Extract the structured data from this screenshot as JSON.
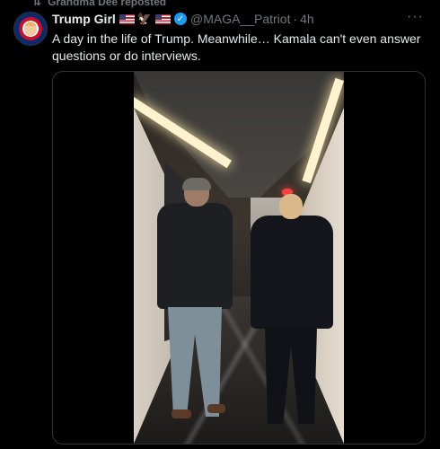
{
  "repost": {
    "icon": "repost-icon",
    "text": "Grandma Dee reposted"
  },
  "tweet": {
    "display_name": "Trump Girl",
    "badges": [
      "us-flag-icon",
      "eagle-icon",
      "us-flag-icon",
      "verified-badge-icon"
    ],
    "handle": "@MAGA__Patriot",
    "separator": "·",
    "time": "4h",
    "more_icon": "more-icon",
    "text": "A day in the life of Trump. Meanwhile… Kamala can't even answer questions or do interviews."
  },
  "media": {
    "type": "video",
    "icon": "video-frame"
  },
  "colors": {
    "background": "#000000",
    "text": "#e7e9ea",
    "muted": "#71767b",
    "verified": "#1d9bf0",
    "border": "#2f3336"
  }
}
